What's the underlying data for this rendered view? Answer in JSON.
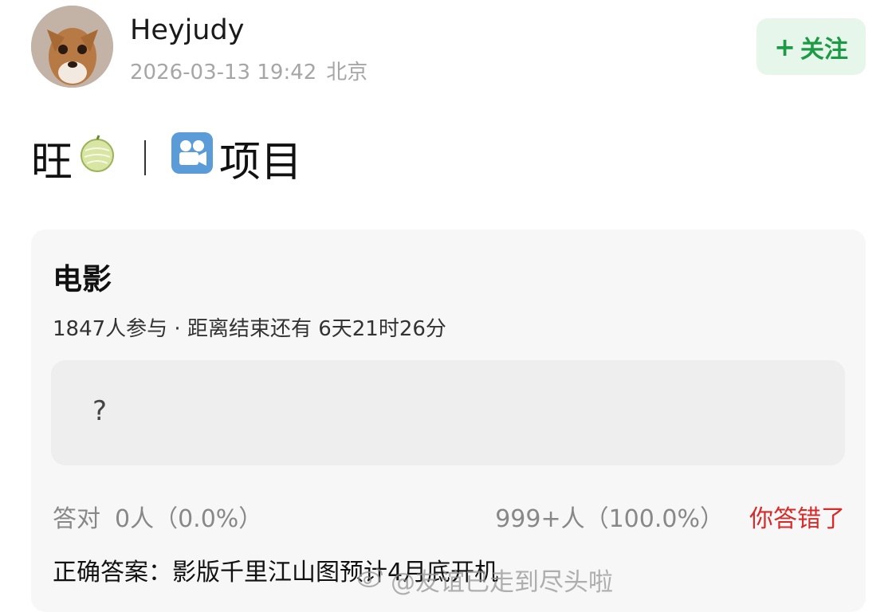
{
  "user": {
    "avatar_icon": "chihuahua-avatar",
    "name": "Heyjudy",
    "timestamp": "2026-03-13 19:42",
    "location": "北京",
    "follow_label": "关注"
  },
  "post": {
    "title_prefix": "旺",
    "title_melon_icon": "melon-icon",
    "title_camera_icon": "movie-camera-icon",
    "title_suffix": "项目"
  },
  "poll": {
    "title": "电影",
    "meta": "1847人参与 · 距离结束还有 6天21时26分",
    "option_text": "?",
    "correct_label": "答对",
    "correct_count": "0人（0.0%）",
    "wrong_count": "999+人（100.0%）",
    "wrong_status": "你答错了",
    "answer": "正确答案：影版千里江山图预计4月底开机"
  },
  "watermark": {
    "icon": "weibo-icon",
    "text": "@友谊已走到尽头啦"
  },
  "colors": {
    "follow_bg": "#e6f6ea",
    "follow_text": "#1d9a46",
    "wrong_text": "#d52b2b"
  }
}
